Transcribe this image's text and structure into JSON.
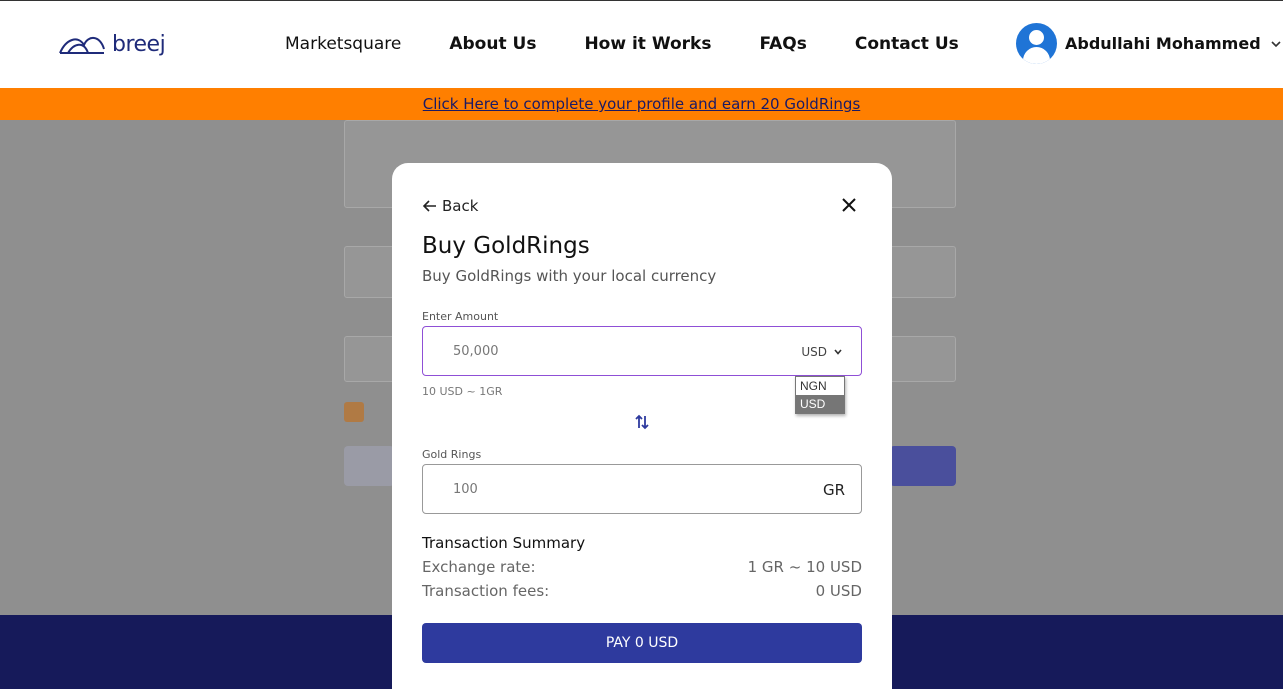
{
  "header": {
    "logo_text": "breej",
    "nav": [
      "Marketsquare",
      "About Us",
      "How it Works",
      "FAQs",
      "Contact Us"
    ],
    "user_name": "Abdullahi Mohammed"
  },
  "promo": {
    "text": "Click Here to complete your profile and earn 20 GoldRings"
  },
  "modal": {
    "back_label": "Back",
    "title": "Buy GoldRings",
    "subtitle": "Buy GoldRings with your local currency",
    "amount_label": "Enter Amount",
    "amount_value": "50,000",
    "currency_selected": "USD",
    "currency_options": [
      "NGN",
      "USD"
    ],
    "rate_hint": "10 USD ~ 1GR",
    "gold_label": "Gold Rings",
    "gold_value": "100",
    "gold_unit": "GR",
    "summary_title": "Transaction Summary",
    "exchange_label": "Exchange rate:",
    "exchange_value": "1 GR ~ 10 USD",
    "fees_label": "Transaction fees:",
    "fees_value": "0 USD",
    "pay_label": "PAY 0 USD"
  },
  "colors": {
    "brand": "#1f2b7a",
    "promo_bg": "#ff7f00",
    "primary_button": "#2e3a9e",
    "footer": "#161a5a",
    "avatar": "#1f74d6"
  }
}
